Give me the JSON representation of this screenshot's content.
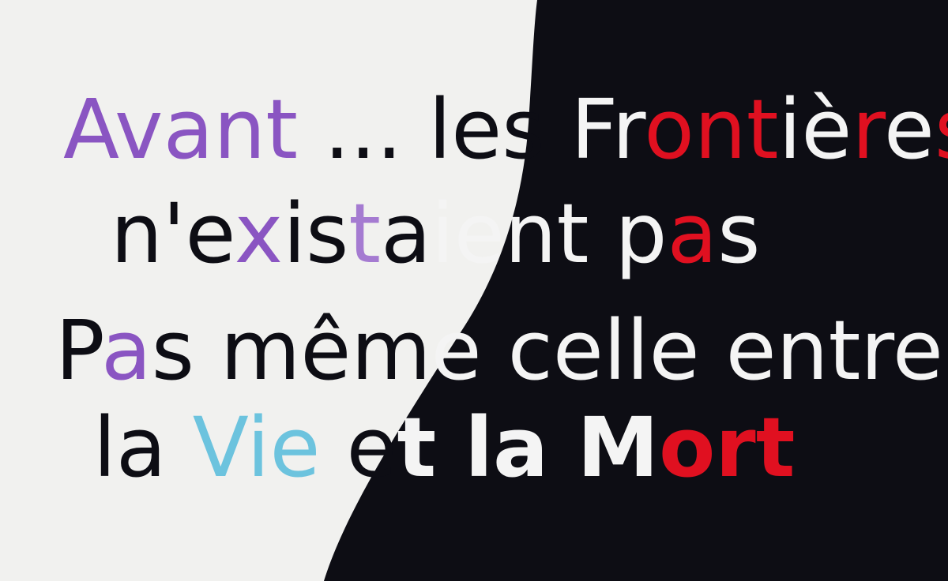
{
  "colors": {
    "paper": "#f1f1ef",
    "black": "#0d0d14",
    "purple": "#8a55c2",
    "lilac": "#a57bd1",
    "red": "#e01020",
    "white": "#f4f4f4",
    "cyan": "#6cc3de"
  },
  "lines": [
    [
      {
        "text": "Avant",
        "color": "#8a55c2"
      },
      {
        "text": " ... les ",
        "color": "#0d0d14"
      },
      {
        "text": "Fr",
        "color": "#f4f4f4"
      },
      {
        "text": "on",
        "color": "#e01020"
      },
      {
        "text": "t",
        "color": "#e01020"
      },
      {
        "text": "iè",
        "color": "#f4f4f4"
      },
      {
        "text": "r",
        "color": "#e01020"
      },
      {
        "text": "e",
        "color": "#f4f4f4"
      },
      {
        "text": "s",
        "color": "#e01020"
      }
    ],
    [
      {
        "text": "n'e",
        "color": "#0d0d14"
      },
      {
        "text": "x",
        "color": "#8a55c2"
      },
      {
        "text": "is",
        "color": "#0d0d14"
      },
      {
        "text": "t",
        "color": "#a57bd1"
      },
      {
        "text": "a",
        "color": "#0d0d14"
      },
      {
        "text": "ient p",
        "color": "#f4f4f4"
      },
      {
        "text": "a",
        "color": "#e01020"
      },
      {
        "text": "s",
        "color": "#f4f4f4"
      }
    ],
    [
      {
        "text": "P",
        "color": "#0d0d14"
      },
      {
        "text": "a",
        "color": "#8a55c2"
      },
      {
        "text": "s mêm",
        "color": "#0d0d14"
      },
      {
        "text": "e celle entre",
        "color": "#f4f4f4"
      }
    ],
    [
      {
        "text": "la ",
        "color": "#0d0d14"
      },
      {
        "text": "Vie",
        "color": "#6cc3de"
      },
      {
        "text": " e",
        "color": "#0d0d14"
      },
      {
        "text": "t la M",
        "color": "#f4f4f4",
        "bold": true
      },
      {
        "text": "or",
        "color": "#e01020",
        "bold": true
      },
      {
        "text": "t",
        "color": "#e01020",
        "bold": true
      }
    ]
  ]
}
